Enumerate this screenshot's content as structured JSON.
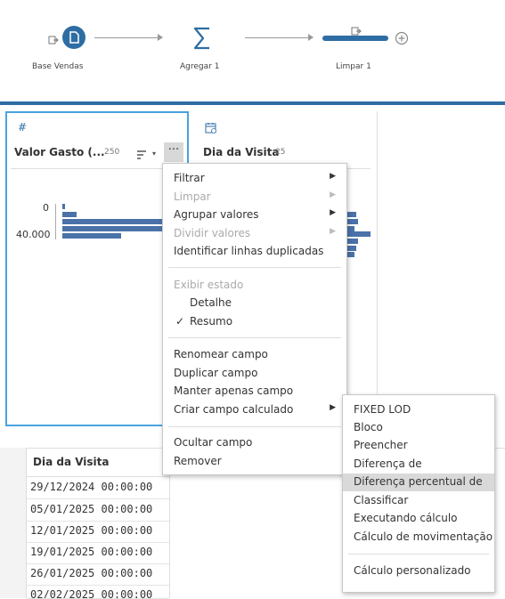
{
  "flow": {
    "steps": [
      {
        "label": "Base Vendas",
        "icon": "input-file-icon"
      },
      {
        "label": "Agregar 1",
        "icon": "sigma-icon"
      },
      {
        "label": "Limpar 1",
        "icon": "clean-step-icon"
      }
    ],
    "add_icon": "plus-circle-icon"
  },
  "cards": [
    {
      "type_icon": "hash-icon",
      "type_glyph": "#",
      "title": "Valor Gasto (...",
      "count": "250",
      "axis_top": "0",
      "axis_bottom": "40.000"
    },
    {
      "type_icon": "calendar-icon",
      "title": "Dia da Visita",
      "count": "25"
    }
  ],
  "colors": {
    "accent": "#2e6da4",
    "bar": "#4a72a8",
    "selection": "#4aa3df",
    "highlight": "#d9d9d9"
  },
  "context_menu": {
    "filtrar": "Filtrar",
    "limpar": "Limpar",
    "agrupar": "Agrupar valores",
    "dividir": "Dividir valores",
    "duplicadas": "Identificar linhas duplicadas",
    "exibir_estado": "Exibir estado",
    "detalhe": "Detalhe",
    "resumo": "Resumo",
    "check": "✓",
    "renomear": "Renomear campo",
    "duplicar": "Duplicar campo",
    "manter": "Manter apenas campo",
    "criar_calc": "Criar campo calculado",
    "ocultar": "Ocultar campo",
    "remover": "Remover",
    "ellipsis": "···"
  },
  "submenu": {
    "fixed_lod": "FIXED LOD",
    "bloco": "Bloco",
    "preencher": "Preencher",
    "diferenca": "Diferença de",
    "diferenca_pct": "Diferença percentual de",
    "classificar": "Classificar",
    "executando": "Executando cálculo",
    "movimentacao": "Cálculo de movimentação",
    "personalizado": "Cálculo personalizado"
  },
  "table": {
    "header": "Dia da Visita",
    "rows": [
      "29/12/2024 00:00:00",
      "05/01/2025 00:00:00",
      "12/01/2025 00:00:00",
      "19/01/2025 00:00:00",
      "26/01/2025 00:00:00",
      "02/02/2025 00:00:00"
    ]
  }
}
